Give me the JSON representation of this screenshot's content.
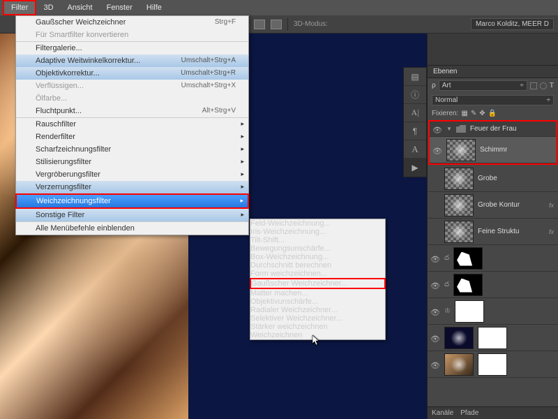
{
  "menubar": [
    "Filter",
    "3D",
    "Ansicht",
    "Fenster",
    "Hilfe"
  ],
  "toolbar": {
    "mode": "3D-Modus:",
    "user": "Marco Kolditz, MEER D"
  },
  "filterMenu": {
    "last": {
      "label": "Gaußscher Weichzeichner",
      "shortcut": "Strg+F"
    },
    "smart": "Für Smartfilter konvertieren",
    "gallery": "Filtergalerie...",
    "adaptive": {
      "label": "Adaptive Weitwinkelkorrektur...",
      "shortcut": "Umschalt+Strg+A"
    },
    "lens": {
      "label": "Objektivkorrektur...",
      "shortcut": "Umschalt+Strg+R"
    },
    "liquify": {
      "label": "Verflüssigen...",
      "shortcut": "Umschalt+Strg+X"
    },
    "oil": "Ölfarbe...",
    "vanish": {
      "label": "Fluchtpunkt...",
      "shortcut": "Alt+Strg+V"
    },
    "noise": "Rauschfilter",
    "render": "Renderfilter",
    "sharpen": "Scharfzeichnungsfilter",
    "stylize": "Stilisierungsfilter",
    "pixelate": "Vergröberungsfilter",
    "distort": "Verzerrungsfilter",
    "blur": "Weichzeichnungsfilter",
    "other": "Sonstige Filter",
    "showAll": "Alle Menübefehle einblenden"
  },
  "blurSubmenu": {
    "field": "Feld-Weichzeichnung...",
    "iris": "Iris-Weichzeichnung...",
    "tilt": "Tilt-Shift...",
    "motion": "Bewegungsunschärfe...",
    "box": "Box-Weichzeichnung...",
    "average": "Durchschnitt berechnen",
    "shape": "Form weichzeichnen...",
    "gaussian": "Gaußscher Weichzeichner...",
    "matte": "Matter machen...",
    "lensblur": "Objektivunschärfe...",
    "radial": "Radialer Weichzeichner...",
    "selective": "Selektiver Weichzeichner...",
    "more": "Stärker weichzeichnen",
    "simple": "Weichzeichnen"
  },
  "panels": {
    "ebenen": "Ebenen",
    "kind": "Art",
    "blend": "Normal",
    "lock": "Fixieren:",
    "kanale": "Kanäle",
    "pfade": "Pfade"
  },
  "layers": {
    "group": "Feuer der Frau",
    "l1": "Schimmr",
    "l2": "Grobe",
    "l3": "Grobe Kontur",
    "l4": "Feine Struktu"
  }
}
